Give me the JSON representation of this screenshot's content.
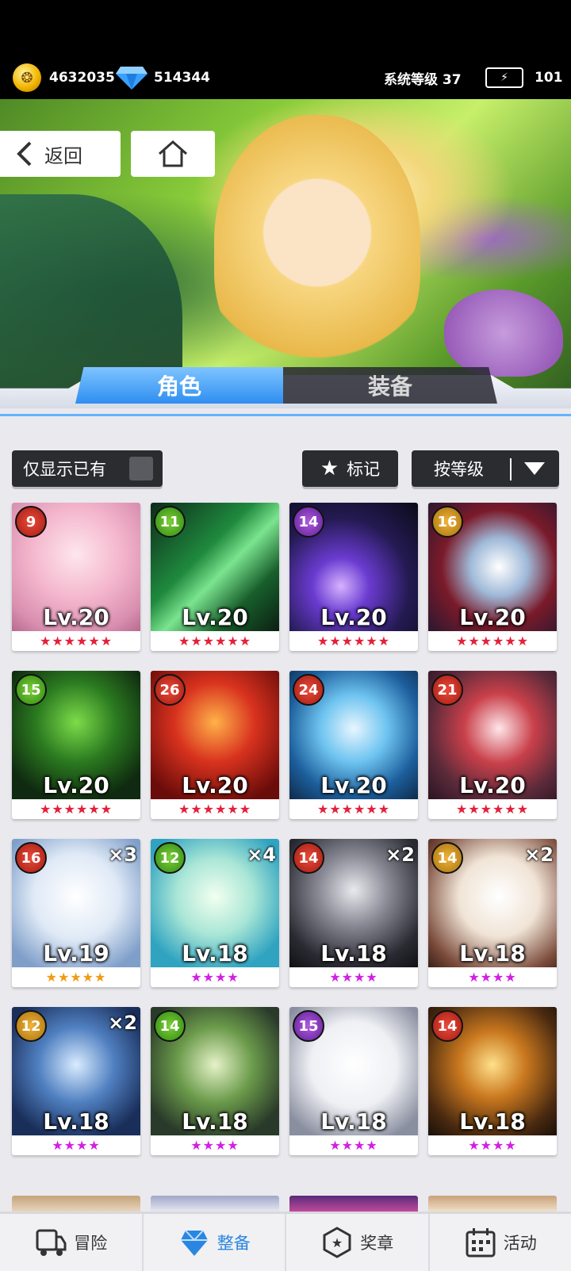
{
  "header": {
    "coins": "4632035",
    "gems": "514344",
    "system_level": "系统等级 37",
    "energy": "101"
  },
  "banner": {
    "back_label": "返回"
  },
  "tabs": [
    {
      "label": "角色",
      "active": true
    },
    {
      "label": "装备",
      "active": false
    }
  ],
  "filters": {
    "owned_only_label": "仅显示已有",
    "mark_label": "标记",
    "sort_label": "按等级"
  },
  "cards": [
    {
      "badge": "9",
      "level": "Lv.20",
      "stars": "★★★★★★",
      "star_color": "#e3203b",
      "mult": ""
    },
    {
      "badge": "11",
      "level": "Lv.20",
      "stars": "★★★★★★",
      "star_color": "#e3203b",
      "mult": ""
    },
    {
      "badge": "14",
      "level": "Lv.20",
      "stars": "★★★★★★",
      "star_color": "#e3203b",
      "mult": ""
    },
    {
      "badge": "16",
      "level": "Lv.20",
      "stars": "★★★★★★",
      "star_color": "#e3203b",
      "mult": ""
    },
    {
      "badge": "15",
      "level": "Lv.20",
      "stars": "★★★★★★",
      "star_color": "#e3203b",
      "mult": ""
    },
    {
      "badge": "26",
      "level": "Lv.20",
      "stars": "★★★★★★",
      "star_color": "#e3203b",
      "mult": ""
    },
    {
      "badge": "24",
      "level": "Lv.20",
      "stars": "★★★★★★",
      "star_color": "#e3203b",
      "mult": ""
    },
    {
      "badge": "21",
      "level": "Lv.20",
      "stars": "★★★★★★",
      "star_color": "#e3203b",
      "mult": ""
    },
    {
      "badge": "16",
      "level": "Lv.19",
      "stars": "★★★★★",
      "star_color": "#f29a12",
      "mult": "×3"
    },
    {
      "badge": "12",
      "level": "Lv.18",
      "stars": "★★★★",
      "star_color": "#d21fe3",
      "mult": "×4"
    },
    {
      "badge": "14",
      "level": "Lv.18",
      "stars": "★★★★",
      "star_color": "#d21fe3",
      "mult": "×2"
    },
    {
      "badge": "14",
      "level": "Lv.18",
      "stars": "★★★★",
      "star_color": "#d21fe3",
      "mult": "×2"
    },
    {
      "badge": "12",
      "level": "Lv.18",
      "stars": "★★★★",
      "star_color": "#d21fe3",
      "mult": "×2"
    },
    {
      "badge": "14",
      "level": "Lv.18",
      "stars": "★★★★",
      "star_color": "#d21fe3",
      "mult": ""
    },
    {
      "badge": "15",
      "level": "Lv.18",
      "stars": "★★★★",
      "star_color": "#d21fe3",
      "mult": ""
    },
    {
      "badge": "14",
      "level": "Lv.18",
      "stars": "★★★★",
      "star_color": "#d21fe3",
      "mult": ""
    }
  ],
  "nav": [
    {
      "label": "冒险",
      "icon": "truck-icon",
      "active": false
    },
    {
      "label": "整备",
      "icon": "gem-heart-icon",
      "active": true
    },
    {
      "label": "奖章",
      "icon": "medal-icon",
      "active": false
    },
    {
      "label": "活动",
      "icon": "calendar-icon",
      "active": false
    }
  ]
}
